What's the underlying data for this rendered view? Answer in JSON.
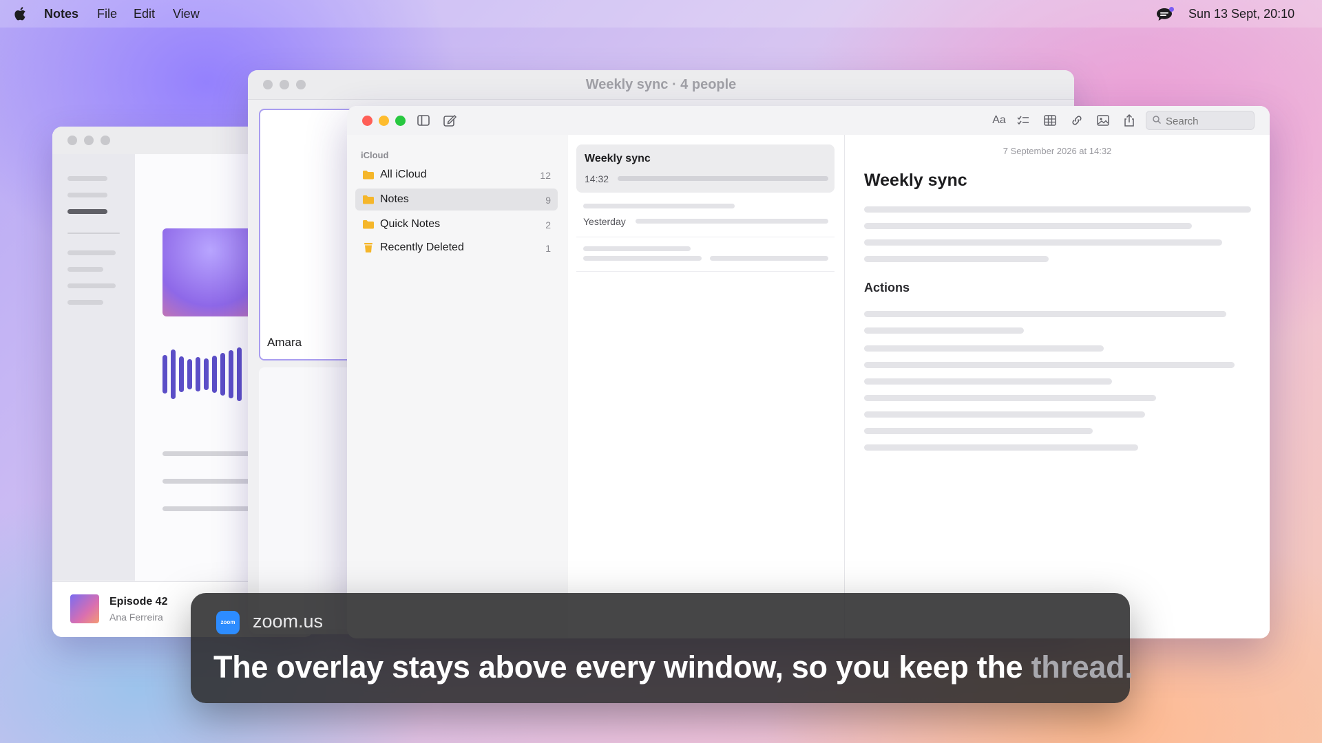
{
  "menubar": {
    "app_name": "Notes",
    "menus": [
      "File",
      "Edit",
      "View"
    ],
    "clock": "Sun 13 Sept, 20:10",
    "icons": [
      "apple-logo-icon",
      "chat-bubble-icon"
    ]
  },
  "podcast_window": {
    "episode_title": "Episode 42",
    "episode_author": "Ana Ferreira"
  },
  "call_window": {
    "title": "Weekly sync · 4 people",
    "participant_name": "Amara"
  },
  "notes_window": {
    "search_placeholder": "Search",
    "toolbar_icons": [
      "sidebar-toggle-icon",
      "compose-icon",
      "text-format-icon",
      "checklist-icon",
      "table-icon",
      "link-icon",
      "image-icon",
      "share-icon",
      "search-icon"
    ],
    "format_label": "Aa",
    "section_label": "iCloud",
    "folders": [
      {
        "label": "All iCloud",
        "count": "12",
        "icon": "folder-icon"
      },
      {
        "label": "Notes",
        "count": "9",
        "icon": "folder-icon",
        "selected": true
      },
      {
        "label": "Quick Notes",
        "count": "2",
        "icon": "folder-icon"
      },
      {
        "label": "Recently Deleted",
        "count": "1",
        "icon": "trash-icon"
      }
    ],
    "notes": [
      {
        "title": "Weekly sync",
        "time": "14:32",
        "selected": true
      },
      {
        "title": "",
        "time": "Yesterday"
      },
      {
        "title": "",
        "time": ""
      }
    ],
    "editor": {
      "date": "7 September 2026 at 14:32",
      "title": "Weekly sync",
      "heading": "Actions"
    }
  },
  "overlay": {
    "app_name": "zoom.us",
    "logo_text": "zoom",
    "caption_main": "The overlay stays above every window, so you keep the ",
    "caption_faded": "thread."
  },
  "colors": {
    "accent_zoom": "#2d8cff",
    "folder_yellow": "#f5b62a",
    "close_red": "#ff5f57",
    "minimize_yellow": "#febc2e",
    "zoom_green": "#28c840",
    "waveform": "#5b4ec7"
  }
}
